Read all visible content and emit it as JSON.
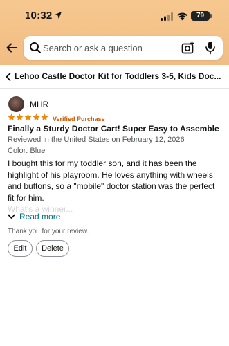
{
  "status_bar": {
    "time": "10:32",
    "battery": "79"
  },
  "search": {
    "placeholder": "Search or ask a question"
  },
  "breadcrumb": {
    "product_title": "Lehoo Castle Doctor Kit for Toddlers 3-5, Kids Doc..."
  },
  "review": {
    "reviewer_name": "MHR",
    "rating": 5,
    "max_rating": 5,
    "verified_label": "Verified Purchase",
    "headline": "Finally a Sturdy Doctor Cart! Super Easy to Assemble",
    "reviewed_meta": "Reviewed in the United States on February 12, 2026",
    "color_variant": "Color: Blue",
    "body": "I bought this for my toddler son, and it has been the highlight of his playroom. He loves anything with wheels and buttons, so a \"mobile\" doctor station was the perfect fit for him.",
    "faded_line": "What's a winner...",
    "read_more_label": "Read more",
    "thanks_text": "Thank you for your review.",
    "edit_label": "Edit",
    "delete_label": "Delete"
  },
  "colors": {
    "header_bg": "#f3c289",
    "star": "#f08804",
    "verified": "#c45500",
    "link": "#007185"
  }
}
